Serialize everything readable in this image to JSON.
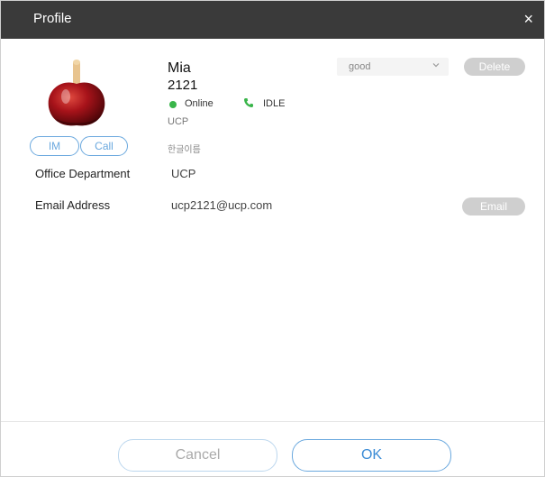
{
  "dialog": {
    "title": "Profile",
    "close_icon": "×"
  },
  "profile": {
    "name": "Mia",
    "extension": "2121",
    "status": "Online",
    "status_color": "#39b54a",
    "phone_status": "IDLE",
    "org": "UCP",
    "korean_name": "한글이름"
  },
  "actions": {
    "im_label": "IM",
    "call_label": "Call",
    "group_select_value": "good",
    "group_select_icon": "chevron-down-icon",
    "delete_label": "Delete",
    "email_label": "Email"
  },
  "fields": [
    {
      "label": "Office Department",
      "value": "UCP"
    },
    {
      "label": "Email Address",
      "value": "ucp2121@ucp.com"
    }
  ],
  "footer": {
    "cancel_label": "Cancel",
    "ok_label": "OK"
  },
  "colors": {
    "titlebar": "#3a3a3a",
    "accent": "#6aa8de",
    "button_disabled": "#cfcfcf"
  }
}
